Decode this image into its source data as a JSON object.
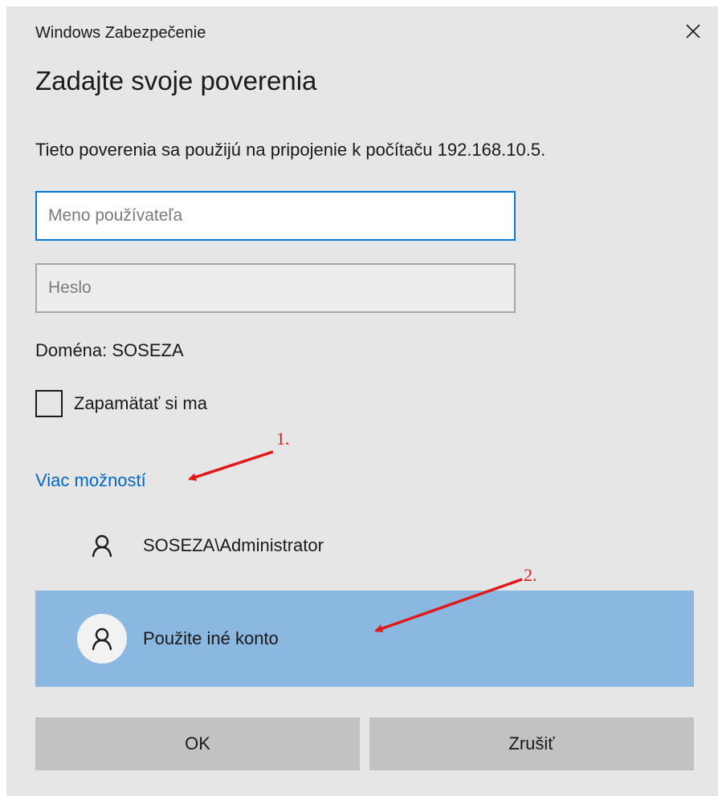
{
  "dialog": {
    "title": "Windows Zabezpečenie",
    "heading": "Zadajte svoje poverenia",
    "description": "Tieto poverenia sa použijú na pripojenie k počítaču 192.168.10.5.",
    "username_placeholder": "Meno používateľa",
    "username_value": "",
    "password_placeholder": "Heslo",
    "password_value": "",
    "domain_text": "Doména: SOSEZA",
    "remember_label": "Zapamätať si ma",
    "remember_checked": false,
    "more_options": "Viac možností",
    "accounts": [
      {
        "label": "SOSEZA\\Administrator",
        "icon": "person-icon",
        "selected": false
      },
      {
        "label": "Použite iné konto",
        "icon": "person-icon",
        "selected": true
      }
    ],
    "ok_label": "OK",
    "cancel_label": "Zrušiť"
  },
  "annotations": [
    {
      "label": "1.",
      "color": "#e0191a"
    },
    {
      "label": "2.",
      "color": "#e0191a"
    }
  ],
  "colors": {
    "dialog_bg": "#e6e6e6",
    "accent": "#0078d7",
    "link": "#0067c0",
    "selected_row": "#8bb8e0",
    "button": "#c2c2c2"
  }
}
